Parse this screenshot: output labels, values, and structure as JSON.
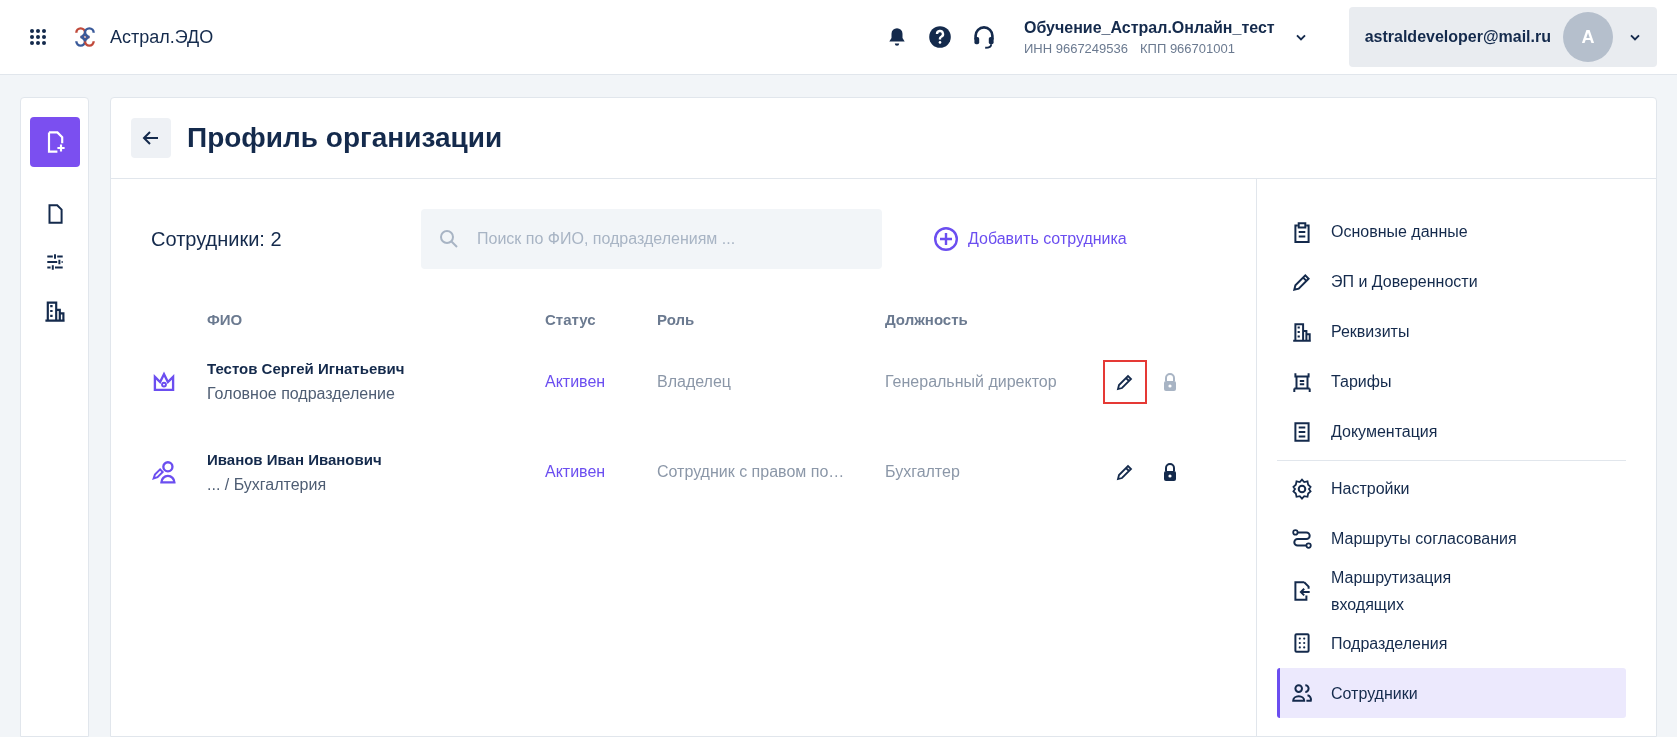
{
  "header": {
    "app_name": "Астрал.ЭДО",
    "org_name": "Обучение_Астрал.Онлайн_тест",
    "org_inn": "ИНН 9667249536",
    "org_kpp": "КПП 966701001",
    "user_email": "astraldeveloper@mail.ru",
    "avatar_letter": "А"
  },
  "page": {
    "title": "Профиль организации"
  },
  "employees": {
    "count_label": "Сотрудники: 2",
    "search": {
      "placeholder": "Поиск по ФИО, подразделениям ..."
    },
    "add_button": "Добавить сотрудника",
    "columns": [
      "ФИО",
      "Статус",
      "Роль",
      "Должность"
    ],
    "rows": [
      {
        "kind": "owner",
        "name": "Тестов Сергей Игнатьевич",
        "unit": "Головное подразделение",
        "status": "Активен",
        "role": "Владелец",
        "position": "Генеральный директор",
        "edit_highlighted": true,
        "lock_disabled": true
      },
      {
        "kind": "signer",
        "name": "Иванов Иван Иванович",
        "unit": "... / Бухгалтерия",
        "status": "Активен",
        "role": "Сотрудник с правом по…",
        "position": "Бухгалтер",
        "edit_highlighted": false,
        "lock_disabled": false
      }
    ]
  },
  "menu_groups": [
    [
      {
        "kind": "clipboard",
        "label": "Основные данные",
        "selected": false
      },
      {
        "kind": "pen",
        "label": "ЭП и Доверенности",
        "selected": false
      },
      {
        "kind": "building",
        "label": "Реквизиты",
        "selected": false
      },
      {
        "kind": "tariff",
        "label": "Тарифы",
        "selected": false
      },
      {
        "kind": "document",
        "label": "Документация",
        "selected": false
      }
    ],
    [
      {
        "kind": "gear",
        "label": "Настройки",
        "selected": false
      },
      {
        "kind": "route",
        "label": "Маршруты согласования",
        "selected": false
      },
      {
        "kind": "incoming",
        "label": "Маршрутизация входящих",
        "selected": false
      },
      {
        "kind": "units",
        "label": "Подразделения",
        "selected": false
      },
      {
        "kind": "people",
        "label": "Сотрудники",
        "selected": true
      }
    ]
  ]
}
